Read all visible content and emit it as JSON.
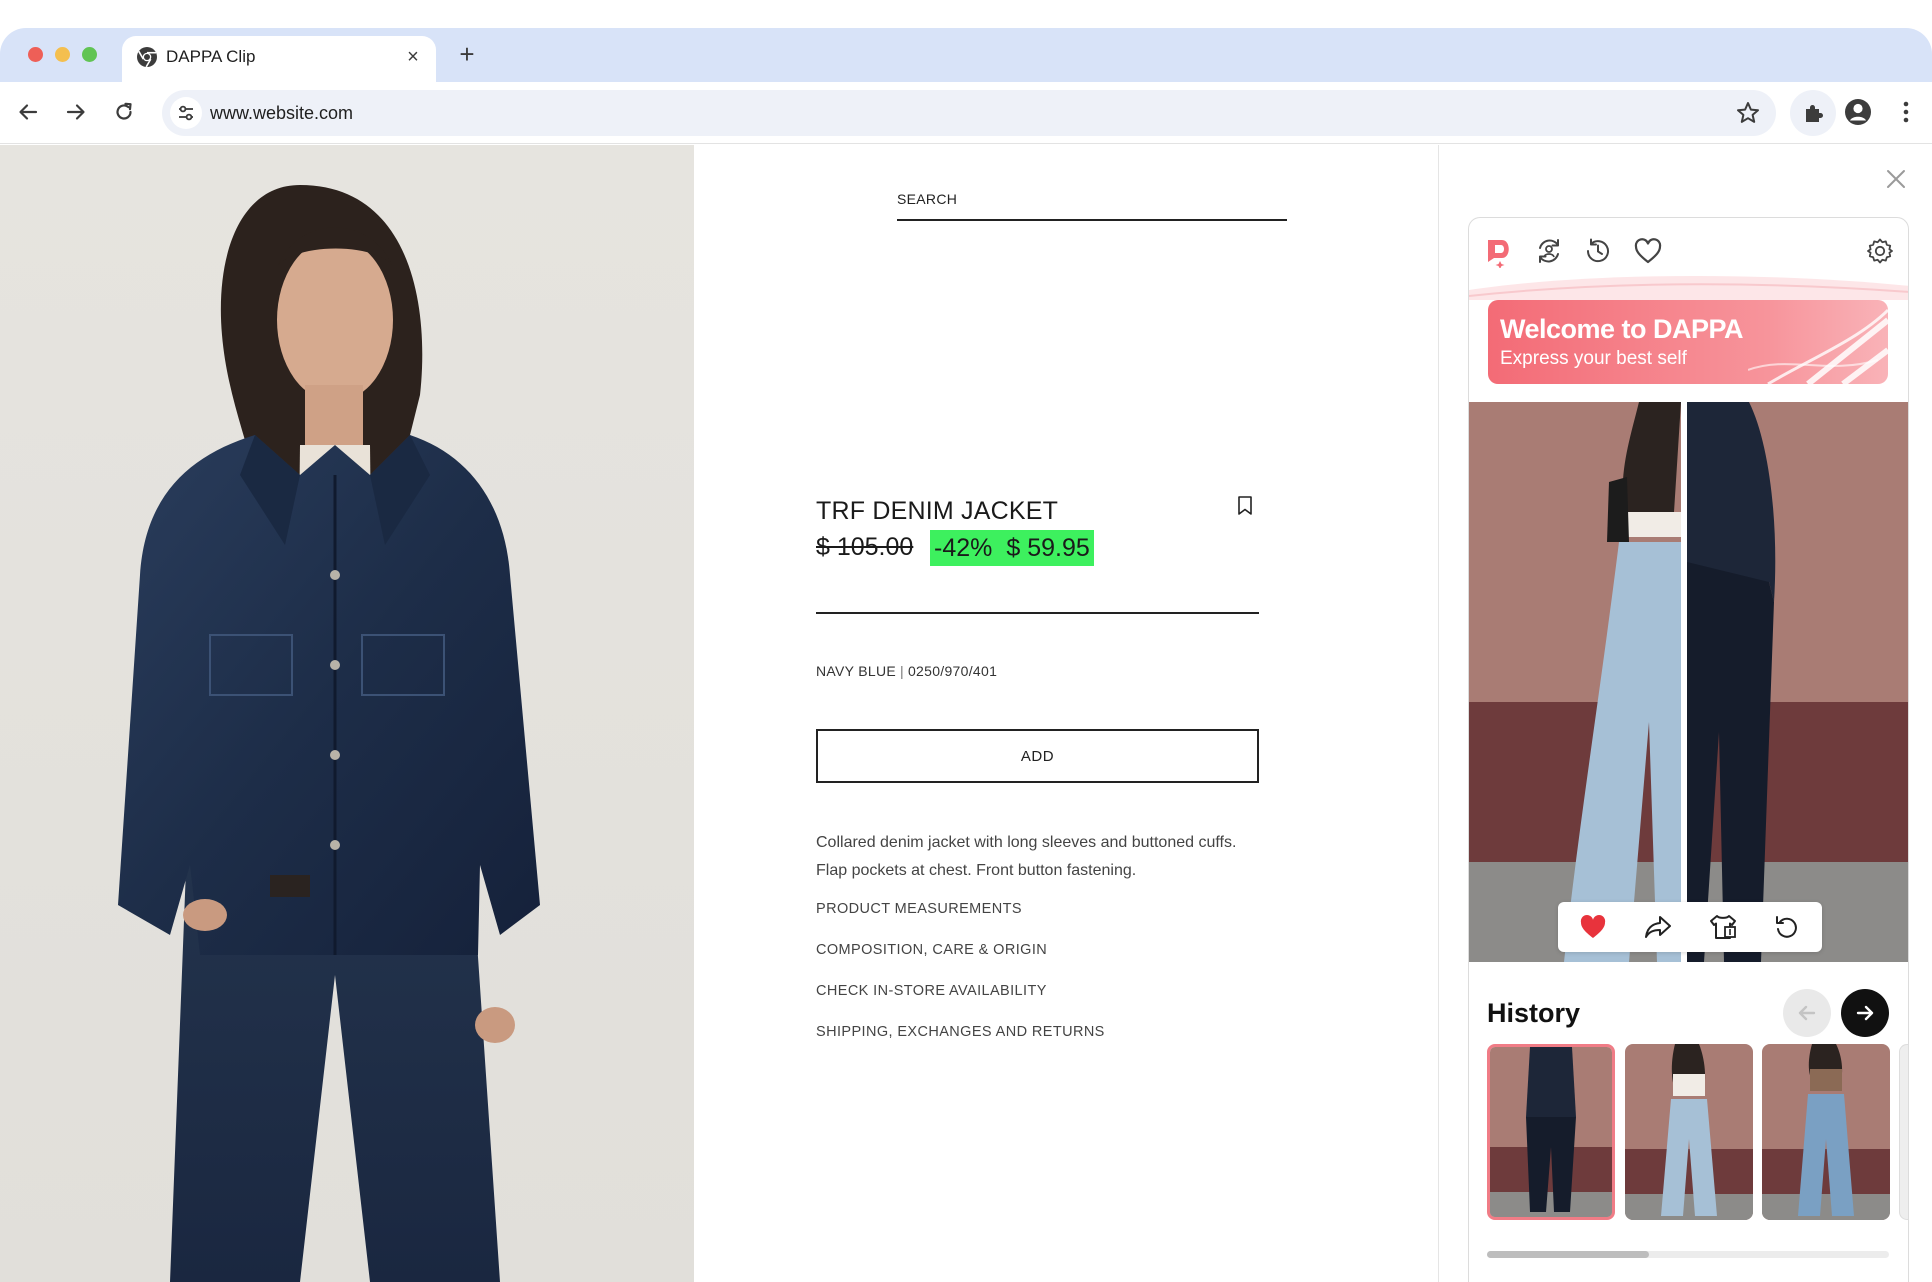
{
  "browser": {
    "tab_title": "DAPPA Clip",
    "tab_close": "×",
    "new_tab": "+",
    "url": "www.website.com"
  },
  "product": {
    "search_label": "SEARCH",
    "title": "TRF DENIM JACKET",
    "old_price": "$ 105.00",
    "discount": "-42%",
    "sale_price": "$ 59.95",
    "color_name": "NAVY BLUE",
    "color_separator": "|",
    "reference": "0250/970/401",
    "add_button": "ADD",
    "description": "Collared denim jacket with long sleeves and buttoned cuffs. Flap pockets at chest. Front button fastening.",
    "links": [
      "PRODUCT MEASUREMENTS",
      "COMPOSITION, CARE & ORIGIN",
      "CHECK IN-STORE AVAILABILITY",
      "SHIPPING, EXCHANGES AND RETURNS"
    ],
    "sale_highlight_color": "#3df05e"
  },
  "dappa": {
    "banner_title": "Welcome to DAPPA",
    "banner_subtitle": "Express your best self",
    "brand_color": "#f36b76",
    "nav_icons": [
      "dappa-logo-icon",
      "swap-style-icon",
      "history-clock-icon",
      "heart-icon",
      "settings-gear-icon"
    ],
    "actions": [
      "heart-filled-icon",
      "share-icon",
      "wardrobe-icon",
      "undo-icon"
    ],
    "history_title": "History",
    "history_items": 3,
    "history_scroll_fraction": 0.4
  }
}
